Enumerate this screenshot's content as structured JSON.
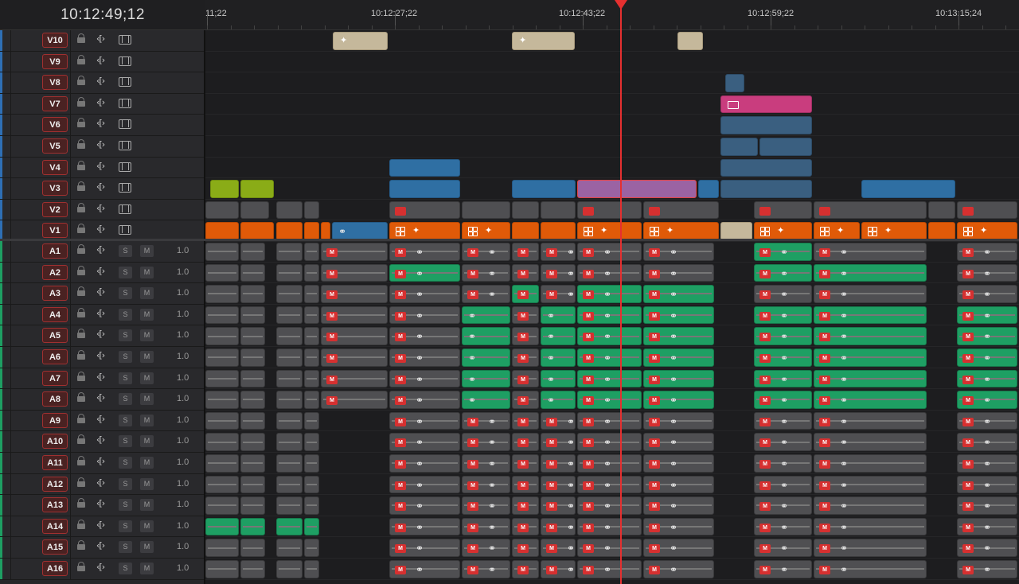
{
  "timeline": {
    "current_timecode": "10:12:49;12",
    "ruler_labels": [
      "11;22",
      "10:12:27;22",
      "10:12:43;22",
      "10:12:59;22",
      "10:13:15;24"
    ]
  },
  "video_tracks": [
    {
      "name": "V10"
    },
    {
      "name": "V9"
    },
    {
      "name": "V8"
    },
    {
      "name": "V7"
    },
    {
      "name": "V6"
    },
    {
      "name": "V5"
    },
    {
      "name": "V4"
    },
    {
      "name": "V3"
    },
    {
      "name": "V2"
    },
    {
      "name": "V1"
    }
  ],
  "audio_tracks": [
    {
      "name": "A1",
      "level": "1.0"
    },
    {
      "name": "A2",
      "level": "1.0"
    },
    {
      "name": "A3",
      "level": "1.0"
    },
    {
      "name": "A4",
      "level": "1.0"
    },
    {
      "name": "A5",
      "level": "1.0"
    },
    {
      "name": "A6",
      "level": "1.0"
    },
    {
      "name": "A7",
      "level": "1.0"
    },
    {
      "name": "A8",
      "level": "1.0"
    },
    {
      "name": "A9",
      "level": "1.0"
    },
    {
      "name": "A10",
      "level": "1.0"
    },
    {
      "name": "A11",
      "level": "1.0"
    },
    {
      "name": "A12",
      "level": "1.0"
    },
    {
      "name": "A13",
      "level": "1.0"
    },
    {
      "name": "A14",
      "level": "1.0"
    },
    {
      "name": "A15",
      "level": "1.0"
    },
    {
      "name": "A16",
      "level": "1.0"
    }
  ],
  "buttons": {
    "solo": "S",
    "mute": "M",
    "trim_icon": "‹[›",
    "mute_badge": "M"
  },
  "colors": {
    "playhead": "#e53030",
    "video_stripe": "#2e6fb5",
    "audio_stripe": "#1e9f63",
    "clip_orange": "#e05a08",
    "clip_blue": "#2f6fa3",
    "clip_green": "#1e9f63",
    "clip_pink": "#c93d7e",
    "clip_tan": "#c5b89b"
  },
  "icons": [
    "lock-icon",
    "trim-icon",
    "filmstrip-icon",
    "link-icon",
    "fx-sparkle-icon",
    "multicam-grid-icon",
    "image-icon",
    "playhead-icon"
  ]
}
